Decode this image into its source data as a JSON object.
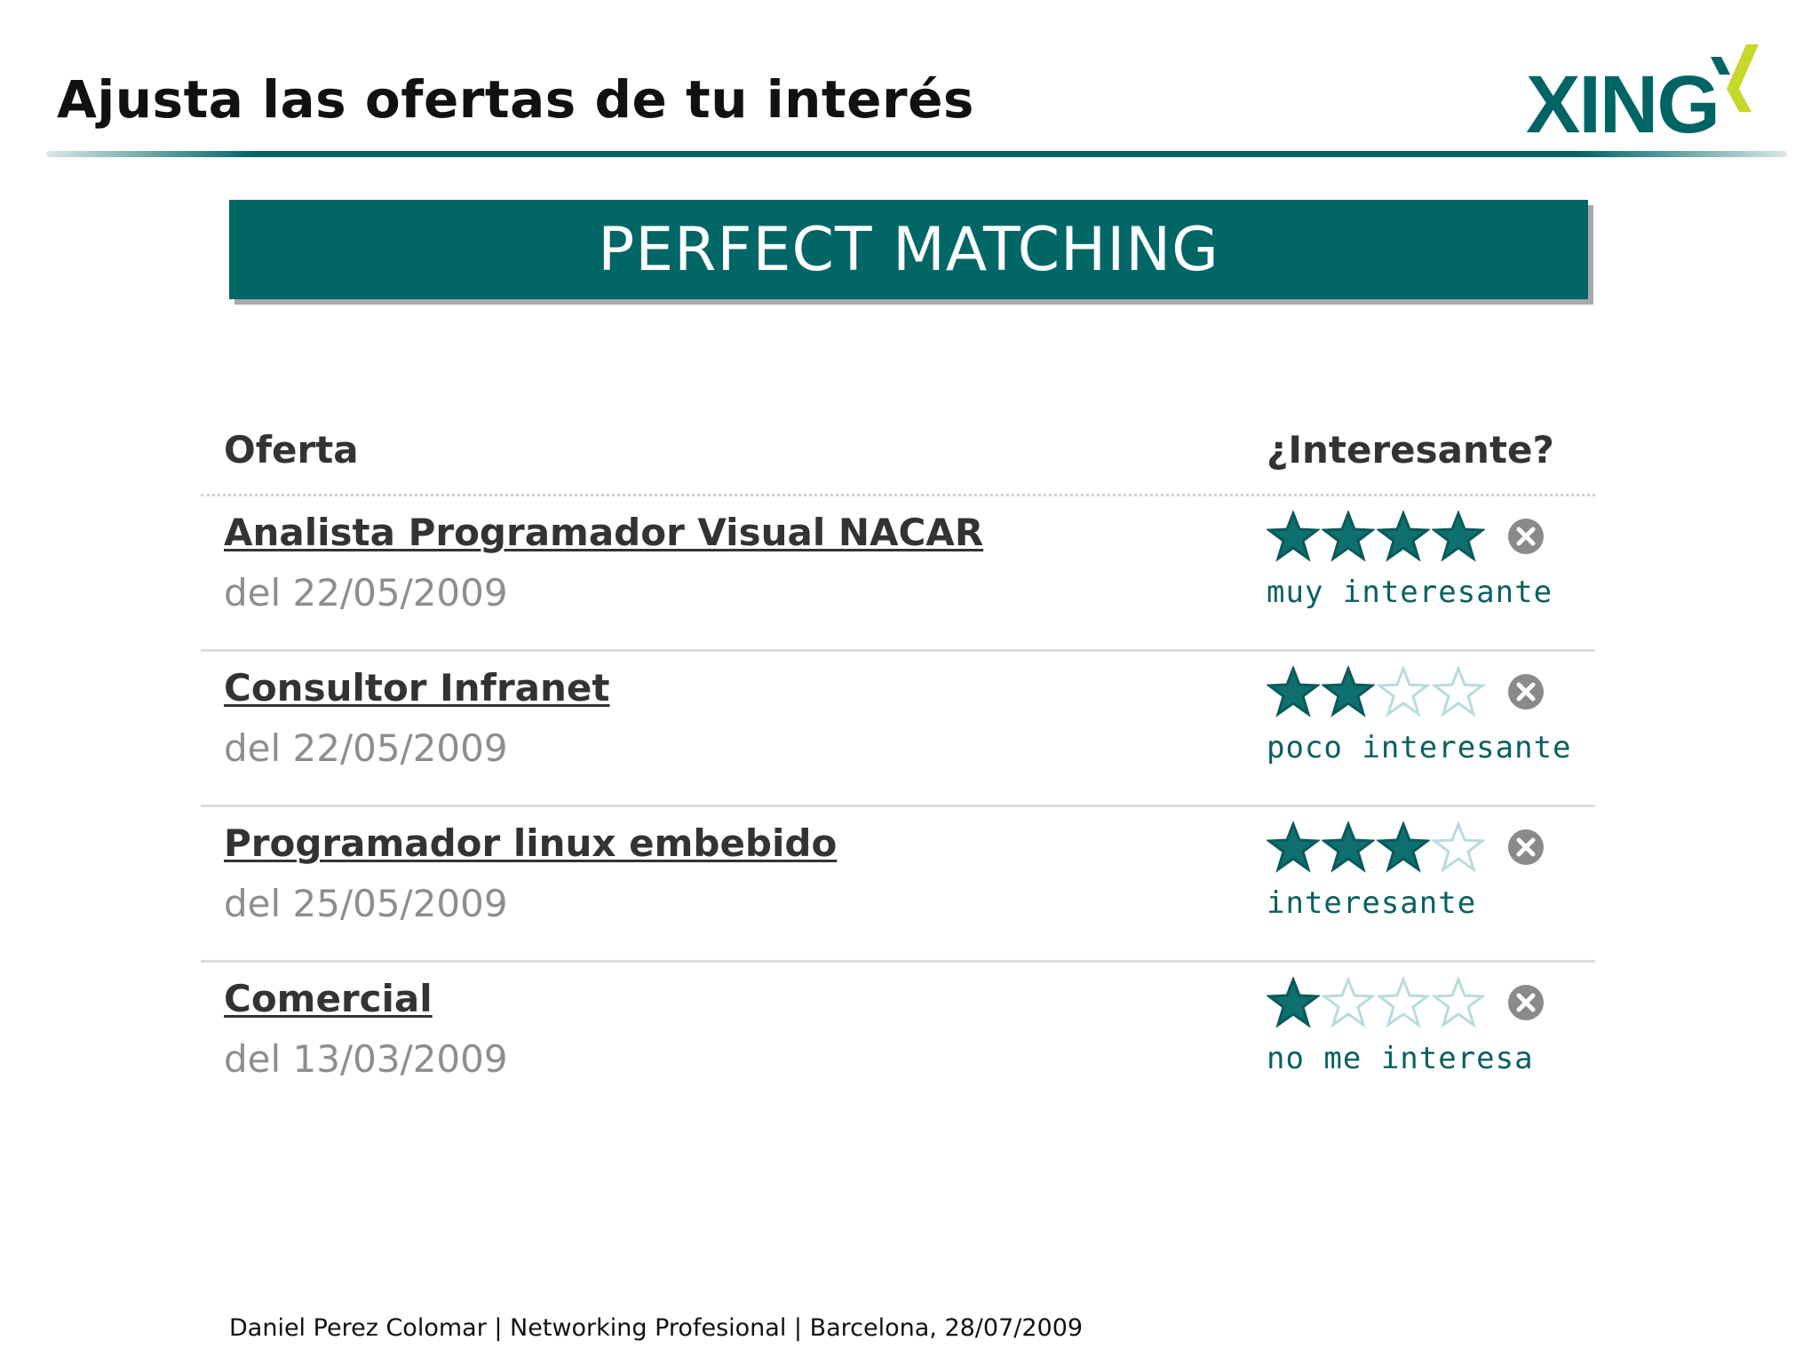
{
  "slide": {
    "title": "Ajusta las ofertas de tu interés",
    "banner": "PERFECT MATCHING",
    "footer": "Daniel Perez Colomar | Networking Profesional | Barcelona, 28/07/2009"
  },
  "logo": {
    "text": "XING",
    "colors": {
      "text": "#006464",
      "mark_dark": "#006464",
      "mark_light": "#c6d82a"
    }
  },
  "table": {
    "headers": {
      "offer": "Oferta",
      "interest": "¿Interesante?"
    },
    "rows": [
      {
        "title": "Analista Programador Visual NACAR",
        "date": "del 22/05/2009",
        "stars": 4,
        "max_stars": 4,
        "label": "muy interesante"
      },
      {
        "title": "Consultor Infranet",
        "date": "del 22/05/2009",
        "stars": 2,
        "max_stars": 4,
        "label": "poco interesante"
      },
      {
        "title": "Programador linux embebido",
        "date": "del 25/05/2009",
        "stars": 3,
        "max_stars": 4,
        "label": "interesante"
      },
      {
        "title": "Comercial",
        "date": "del 13/03/2009",
        "stars": 1,
        "max_stars": 4,
        "label": "no me interesa"
      }
    ]
  },
  "colors": {
    "accent": "#006666",
    "star_filled": "#0e6f6f",
    "star_empty": "#b9dcdc",
    "clear_icon": "#8a8a8a"
  },
  "icons": {
    "rating": "star-icon",
    "clear": "clear-rating-icon"
  }
}
